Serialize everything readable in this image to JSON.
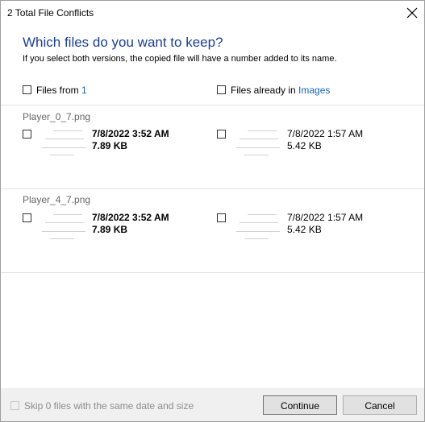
{
  "window": {
    "title": "2 Total File Conflicts"
  },
  "header": {
    "heading": "Which files do you want to keep?",
    "subtext": "If you select both versions, the copied file will have a number added to its name."
  },
  "columns": {
    "left_label": "Files from ",
    "left_link": "1",
    "right_label": "Files already in ",
    "right_link": "Images"
  },
  "conflicts": [
    {
      "name": "Player_0_7.png",
      "left": {
        "date": "7/8/2022 3:52 AM",
        "size": "7.89 KB"
      },
      "right": {
        "date": "7/8/2022 1:57 AM",
        "size": "5.42 KB"
      }
    },
    {
      "name": "Player_4_7.png",
      "left": {
        "date": "7/8/2022 3:52 AM",
        "size": "7.89 KB"
      },
      "right": {
        "date": "7/8/2022 1:57 AM",
        "size": "5.42 KB"
      }
    }
  ],
  "footer": {
    "skip_label": "Skip 0 files with the same date and size",
    "continue_label": "Continue",
    "cancel_label": "Cancel"
  }
}
